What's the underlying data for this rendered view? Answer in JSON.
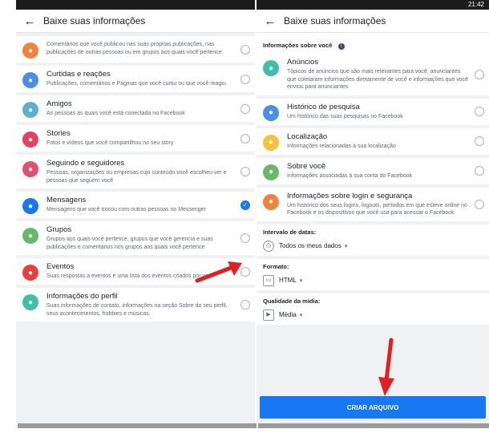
{
  "status_time": "21:42",
  "left": {
    "title": "Baixe suas informações",
    "items": [
      {
        "title": "",
        "desc": "Comentários que você publicou nas suas próprias publicações, nas publicações de outras pessoas ou em grupos aos quais você pertence",
        "color": "#f0843c",
        "icon": "comment-icon",
        "selected": false
      },
      {
        "title": "Curtidas e reações",
        "desc": "Publicações, comentários e Páginas que você curtiu ou que você reagiu",
        "color": "#4a8ee8",
        "icon": "like-icon",
        "selected": false
      },
      {
        "title": "Amigos",
        "desc": "As pessoas às quais você está conectada no Facebook",
        "color": "#5ab0d0",
        "icon": "friends-icon",
        "selected": false
      },
      {
        "title": "Stories",
        "desc": "Fotos e vídeos que você compartilhou no seu story",
        "color": "#e6425e",
        "icon": "stories-icon",
        "selected": false
      },
      {
        "title": "Seguindo e seguidores",
        "desc": "Pessoas, organizações ou empresas cujo conteúdo você escolheu ver e pessoas que seguem você",
        "color": "#e54e6e",
        "icon": "following-icon",
        "selected": false
      },
      {
        "title": "Mensagens",
        "desc": "Mensagens que você trocou com outras pessoas no Messenger",
        "color": "#1877f2",
        "icon": "messenger-icon",
        "selected": true
      },
      {
        "title": "Grupos",
        "desc": "Grupos aos quais você pertence, grupos que você gerencia e suas publicações e comentários nos grupos aos quais você pertence",
        "color": "#67b868",
        "icon": "groups-icon",
        "selected": false
      },
      {
        "title": "Eventos",
        "desc": "Suas respostas a eventos e uma lista dos eventos criados por você",
        "color": "#e8413b",
        "icon": "events-icon",
        "selected": false
      },
      {
        "title": "Informações do perfil",
        "desc": "Suas informações de contato, informações na seção Sobre do seu perfil, seus acontecimentos, hobbies e músicas.",
        "color": "#3fbfa8",
        "icon": "profile-icon",
        "selected": false
      }
    ]
  },
  "right": {
    "title": "Baixe suas informações",
    "section_header": "Informações sobre você",
    "items": [
      {
        "title": "Anúncios",
        "desc": "Tópicos de anúncios que são mais relevantes para você, anunciantes que coletaram informações diretamente de você e informações que você enviou para anunciantes",
        "color": "#3fbfa8",
        "icon": "ads-icon"
      },
      {
        "title": "Histórico de pesquisa",
        "desc": "Um histórico das suas pesquisas no Facebook",
        "color": "#4a8ee8",
        "icon": "search-icon"
      },
      {
        "title": "Localização",
        "desc": "Informações relacionadas à sua localização",
        "color": "#f5c33b",
        "icon": "location-icon"
      },
      {
        "title": "Sobre você",
        "desc": "Informações associadas à sua conta do Facebook",
        "color": "#67b868",
        "icon": "about-icon"
      },
      {
        "title": "Informações sobre login e segurança",
        "desc": "Um histórico dos seus logins, logouts, períodos em que esteve online no Facebook e os dispositivos que você usa para acessar o Facebook",
        "color": "#f0843c",
        "icon": "security-icon"
      }
    ],
    "date_range_label": "Intervalo de datas:",
    "date_range_value": "Todos os meus dados",
    "format_label": "Formato:",
    "format_value": "HTML",
    "quality_label": "Qualidade da mídia:",
    "quality_value": "Média",
    "create_button": "CRIAR ARQUIVO"
  }
}
